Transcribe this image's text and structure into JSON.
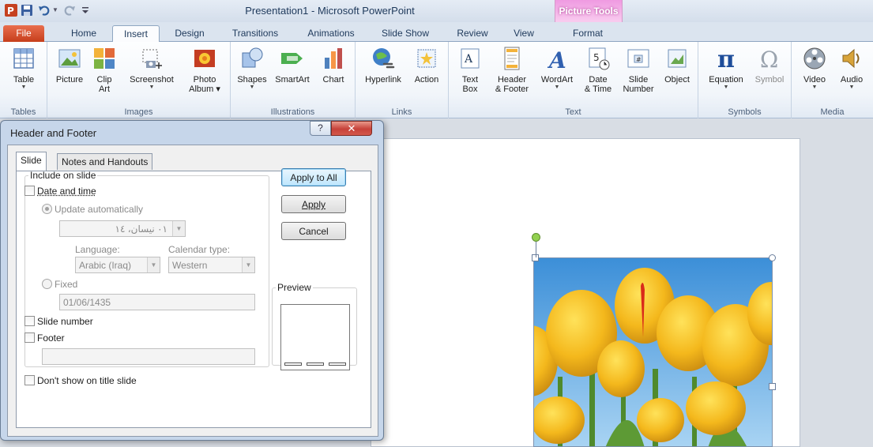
{
  "title_bar": {
    "app_title": "Presentation1 - Microsoft PowerPoint",
    "context_group_label": "Picture Tools",
    "quick_access": [
      "powerpoint-logo-icon",
      "save-icon",
      "undo-icon",
      "redo-icon",
      "customize-quick-access-icon"
    ]
  },
  "tabs": [
    "File",
    "Home",
    "Insert",
    "Design",
    "Transitions",
    "Animations",
    "Slide Show",
    "Review",
    "View",
    "Format"
  ],
  "ribbon": {
    "groups": {
      "tables": "Tables",
      "images": "Images",
      "illustrations": "Illustrations",
      "links": "Links",
      "text": "Text",
      "symbols": "Symbols",
      "media": "Media"
    },
    "buttons": {
      "table": [
        "Table",
        ""
      ],
      "picture": [
        "Picture",
        ""
      ],
      "clip_art": [
        "Clip",
        "Art"
      ],
      "screenshot": [
        "Screenshot",
        ""
      ],
      "photo_album": [
        "Photo",
        "Album ▾"
      ],
      "shapes": [
        "Shapes",
        ""
      ],
      "smartart": [
        "SmartArt",
        ""
      ],
      "chart": [
        "Chart",
        ""
      ],
      "hyperlink": [
        "Hyperlink",
        ""
      ],
      "action": [
        "Action",
        ""
      ],
      "text_box": [
        "Text",
        "Box"
      ],
      "header_footer": [
        "Header",
        "& Footer"
      ],
      "wordart": [
        "WordArt",
        ""
      ],
      "date_time": [
        "Date",
        "& Time"
      ],
      "slide_number": [
        "Slide",
        "Number"
      ],
      "object": [
        "Object",
        ""
      ],
      "equation": [
        "Equation",
        ""
      ],
      "symbol": [
        "Symbol",
        ""
      ],
      "video": [
        "Video",
        ""
      ],
      "audio": [
        "Audio",
        ""
      ]
    }
  },
  "dialog": {
    "title": "Header and Footer",
    "help_label": "?",
    "close_label": "✕",
    "tabs": [
      "Slide",
      "Notes and Handouts"
    ],
    "include_legend": "Include on slide",
    "date_and_time": "Date and time",
    "update_automatically": "Update automatically",
    "date_value": "٠١ نيسان، ١٤",
    "language_label": "Language:",
    "language_value": "Arabic (Iraq)",
    "calendar_label": "Calendar type:",
    "calendar_value": "Western",
    "fixed_label": "Fixed",
    "fixed_value": "01/06/1435",
    "slide_number": "Slide number",
    "footer": "Footer",
    "footer_value": "",
    "dont_show": "Don't show on title slide",
    "preview_legend": "Preview",
    "buttons": {
      "apply_to_all": "Apply to All",
      "apply": "Apply",
      "cancel": "Cancel"
    }
  }
}
